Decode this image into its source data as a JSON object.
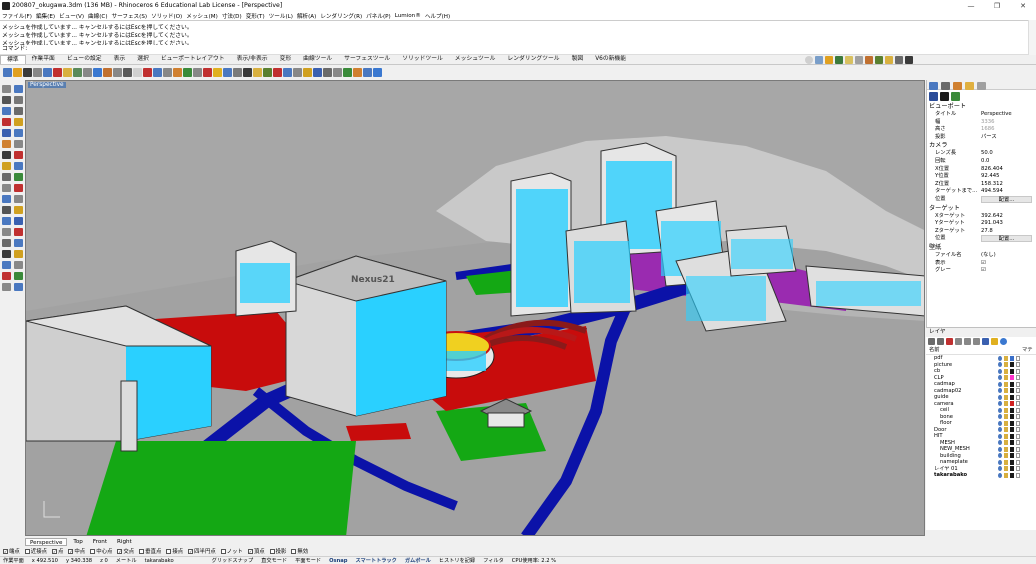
{
  "window": {
    "title": "200807_okugawa.3dm (136 MB) - Rhinoceros 6 Educational Lab License - [Perspective]",
    "controls": [
      "—",
      "❐",
      "✕"
    ]
  },
  "menu": [
    "ファイル(F)",
    "編集(E)",
    "ビュー(V)",
    "曲線(C)",
    "サーフェス(S)",
    "ソリッド(O)",
    "メッシュ(M)",
    "寸法(D)",
    "変形(T)",
    "ツール(L)",
    "解析(A)",
    "レンダリング(R)",
    "パネル(P)",
    "Lumion®",
    "ヘルプ(H)"
  ],
  "command_history": [
    "メッシュを作成しています... キャンセルするにはEscを押してください。",
    "メッシュを作成しています... キャンセルするにはEscを押してください。",
    "メッシュを作成しています... キャンセルするにはEscを押してください。"
  ],
  "command_prompt": "コマンド:",
  "toolbar_tabs": [
    "標準",
    "作業平面",
    "ビューの設定",
    "表示",
    "選択",
    "ビューポートレイアウト",
    "表示/非表示",
    "変形",
    "曲線ツール",
    "サーフェスツール",
    "ソリッドツール",
    "メッシュツール",
    "レンダリングツール",
    "製図",
    "V6の新機能"
  ],
  "active_tab": "標準",
  "viewport": {
    "label": "Perspective",
    "building_label": "Nexus21"
  },
  "view_tabs": [
    "Perspective",
    "Top",
    "Front",
    "Right"
  ],
  "osnaps": [
    {
      "label": "端点",
      "checked": true
    },
    {
      "label": "近接点",
      "checked": false
    },
    {
      "label": "点",
      "checked": true
    },
    {
      "label": "中点",
      "checked": true
    },
    {
      "label": "中心点",
      "checked": false
    },
    {
      "label": "交点",
      "checked": true
    },
    {
      "label": "垂直点",
      "checked": false
    },
    {
      "label": "接点",
      "checked": false
    },
    {
      "label": "四半円点",
      "checked": true
    },
    {
      "label": "ノット",
      "checked": false
    },
    {
      "label": "頂点",
      "checked": true
    },
    {
      "label": "投影",
      "checked": false
    },
    {
      "label": "無効",
      "checked": false
    }
  ],
  "status": {
    "cplane": "作業平面",
    "x": "x 492.510",
    "y": "y 340.338",
    "z": "z 0",
    "units": "メートル",
    "layer": "takarabako",
    "grid_snap": "グリッドスナップ",
    "ortho": "直交モード",
    "planar": "平面モード",
    "osnap": "Osnap",
    "smarttrack": "スマートトラック",
    "gumball": "ガムボール",
    "history": "ヒストリを記録",
    "filter": "フィルタ",
    "cpu": "CPU使用率: 2.2 %"
  },
  "properties": {
    "viewport_section": "ビューポート",
    "viewport_rows": [
      {
        "k": "タイトル",
        "v": "Perspective"
      },
      {
        "k": "幅",
        "v": "3336"
      },
      {
        "k": "高さ",
        "v": "1686"
      },
      {
        "k": "投影",
        "v": "パース"
      }
    ],
    "camera_section": "カメラ",
    "camera_rows": [
      {
        "k": "レンズ長",
        "v": "50.0"
      },
      {
        "k": "回転",
        "v": "0.0"
      },
      {
        "k": "X位置",
        "v": "826.404"
      },
      {
        "k": "Y位置",
        "v": "92.445"
      },
      {
        "k": "Z位置",
        "v": "158.312"
      },
      {
        "k": "ターゲットまで...",
        "v": "494.594"
      },
      {
        "k": "位置",
        "v": "配置..."
      }
    ],
    "target_section": "ターゲット",
    "target_rows": [
      {
        "k": "Xターゲット",
        "v": "392.642"
      },
      {
        "k": "Yターゲット",
        "v": "291.043"
      },
      {
        "k": "Zターゲット",
        "v": "27.8"
      },
      {
        "k": "位置",
        "v": "配置..."
      }
    ],
    "wallpaper_section": "壁紙",
    "wallpaper_rows": [
      {
        "k": "ファイル名",
        "v": "(なし)"
      },
      {
        "k": "表示",
        "v": "☑"
      },
      {
        "k": "グレー",
        "v": "☑"
      }
    ]
  },
  "layers": {
    "panel_title": "レイヤ",
    "column_name": "名前",
    "column_material": "マテ",
    "items": [
      {
        "name": "pdf",
        "indent": 0,
        "color": "#3a6fc9"
      },
      {
        "name": "picture",
        "indent": 0,
        "color": "#1a1a1a"
      },
      {
        "name": "cb",
        "indent": 0,
        "color": "#1a1a1a"
      },
      {
        "name": "CLP",
        "indent": 0,
        "color": "#ff33cc"
      },
      {
        "name": "cadmap",
        "indent": 0,
        "color": "#1a1a1a"
      },
      {
        "name": "cadmap02",
        "indent": 0,
        "color": "#1a1a1a"
      },
      {
        "name": "guide",
        "indent": 0,
        "color": "#1a1a1a"
      },
      {
        "name": "camera",
        "indent": 0,
        "color": "#d02020"
      },
      {
        "name": "ceil",
        "indent": 1,
        "color": "#1a1a1a"
      },
      {
        "name": "bone",
        "indent": 1,
        "color": "#1a1a1a"
      },
      {
        "name": "floor",
        "indent": 1,
        "color": "#1a1a1a"
      },
      {
        "name": "Door",
        "indent": 0,
        "color": "#1a1a1a"
      },
      {
        "name": "HIT",
        "indent": 0,
        "color": "#1a1a1a"
      },
      {
        "name": "MESH",
        "indent": 1,
        "color": "#1a1a1a"
      },
      {
        "name": "NEW_MESH",
        "indent": 1,
        "color": "#1a1a1a"
      },
      {
        "name": "building",
        "indent": 1,
        "color": "#1a1a1a"
      },
      {
        "name": "nameplate",
        "indent": 1,
        "color": "#1a1a1a"
      },
      {
        "name": "レイヤ 01",
        "indent": 0,
        "color": "#1a1a1a"
      },
      {
        "name": "takarabako",
        "indent": 0,
        "color": "#1a1a1a",
        "current": true
      }
    ]
  }
}
